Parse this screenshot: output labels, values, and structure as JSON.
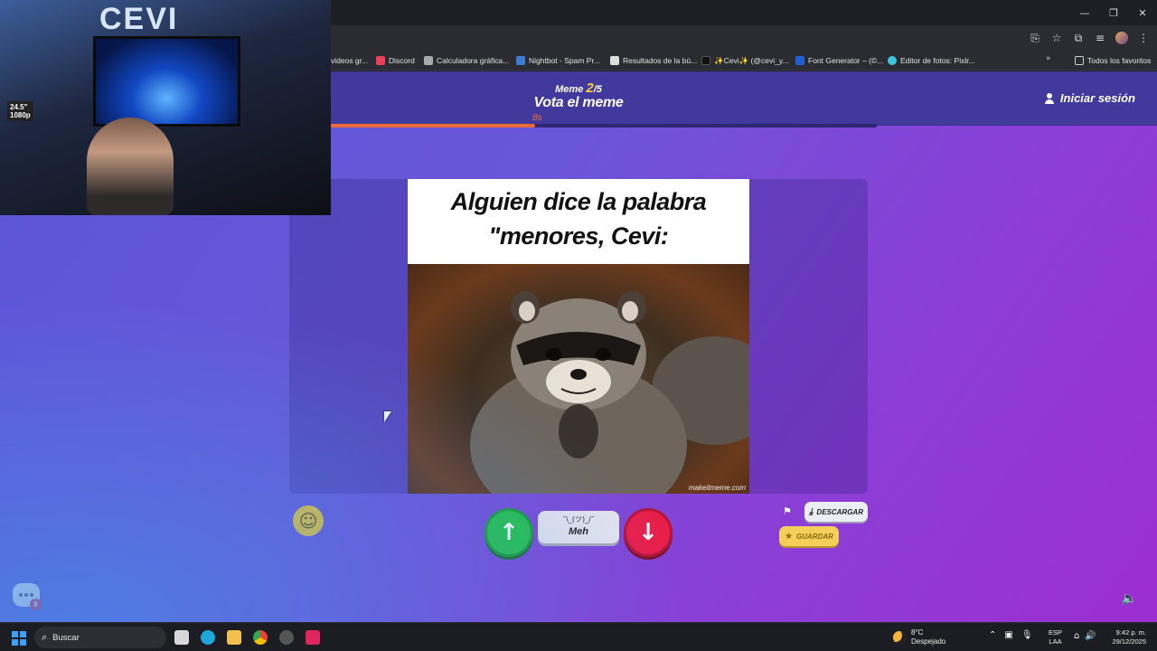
{
  "browser": {
    "bookmarks": [
      {
        "label": "videos gr...",
        "icon": "bookmark-icon",
        "color": "#888888"
      },
      {
        "label": "Discord",
        "icon": "discord-icon",
        "color": "#e8405a"
      },
      {
        "label": "Calculadora gráfica...",
        "icon": "desmos-icon",
        "color": "#aaaaaa"
      },
      {
        "label": "Nightbot - Spam Pr...",
        "icon": "nightbot-icon",
        "color": "#3a7bd5"
      },
      {
        "label": "Resultados de la bú...",
        "icon": "doc-icon",
        "color": "#dddddd"
      },
      {
        "label": "✨Cevi✨ (@cevi_y...",
        "icon": "tiktok-icon",
        "color": "#111111"
      },
      {
        "label": "Font Generator – (©...",
        "icon": "font-icon",
        "color": "#1e5fd1"
      },
      {
        "label": "Editor de fotos: Pixlr...",
        "icon": "pixlr-icon",
        "color": "#3ec6e0"
      }
    ],
    "all_bookmarks": "Todos los favoritos"
  },
  "header": {
    "meme_prefix": "Meme",
    "meme_current": "2",
    "meme_total": "/5",
    "title": "Vota el meme",
    "timer": "8s",
    "progress": 0.41,
    "login_label": "Iniciar sesión"
  },
  "meme": {
    "caption_line1": "Alguien dice la palabra",
    "caption_line2": "\"menores, Cevi:",
    "watermark": "makeitmeme.com"
  },
  "vote": {
    "meh_face": "¯\\_(ツ)_/¯",
    "meh_label": "Meh"
  },
  "actions": {
    "download_label": "DESCARGAR",
    "save_label": "GUARDAR"
  },
  "chat": {
    "badge": "8"
  },
  "webcam": {
    "logo": "CEVI",
    "sticker_line1": "24.5\"",
    "sticker_line2": "1080p"
  },
  "taskbar": {
    "search_placeholder": "Buscar",
    "weather_temp": "8°C",
    "weather_desc": "Despejado",
    "lang_line1": "ESP",
    "lang_line2": "LAA",
    "time": "9:42 p. m.",
    "date": "29/12/2025"
  },
  "colors": {
    "accent_orange": "#ef6b3a",
    "upvote_green": "#27c24a",
    "downvote_red": "#e81e4a",
    "save_yellow": "#f4d05a"
  }
}
